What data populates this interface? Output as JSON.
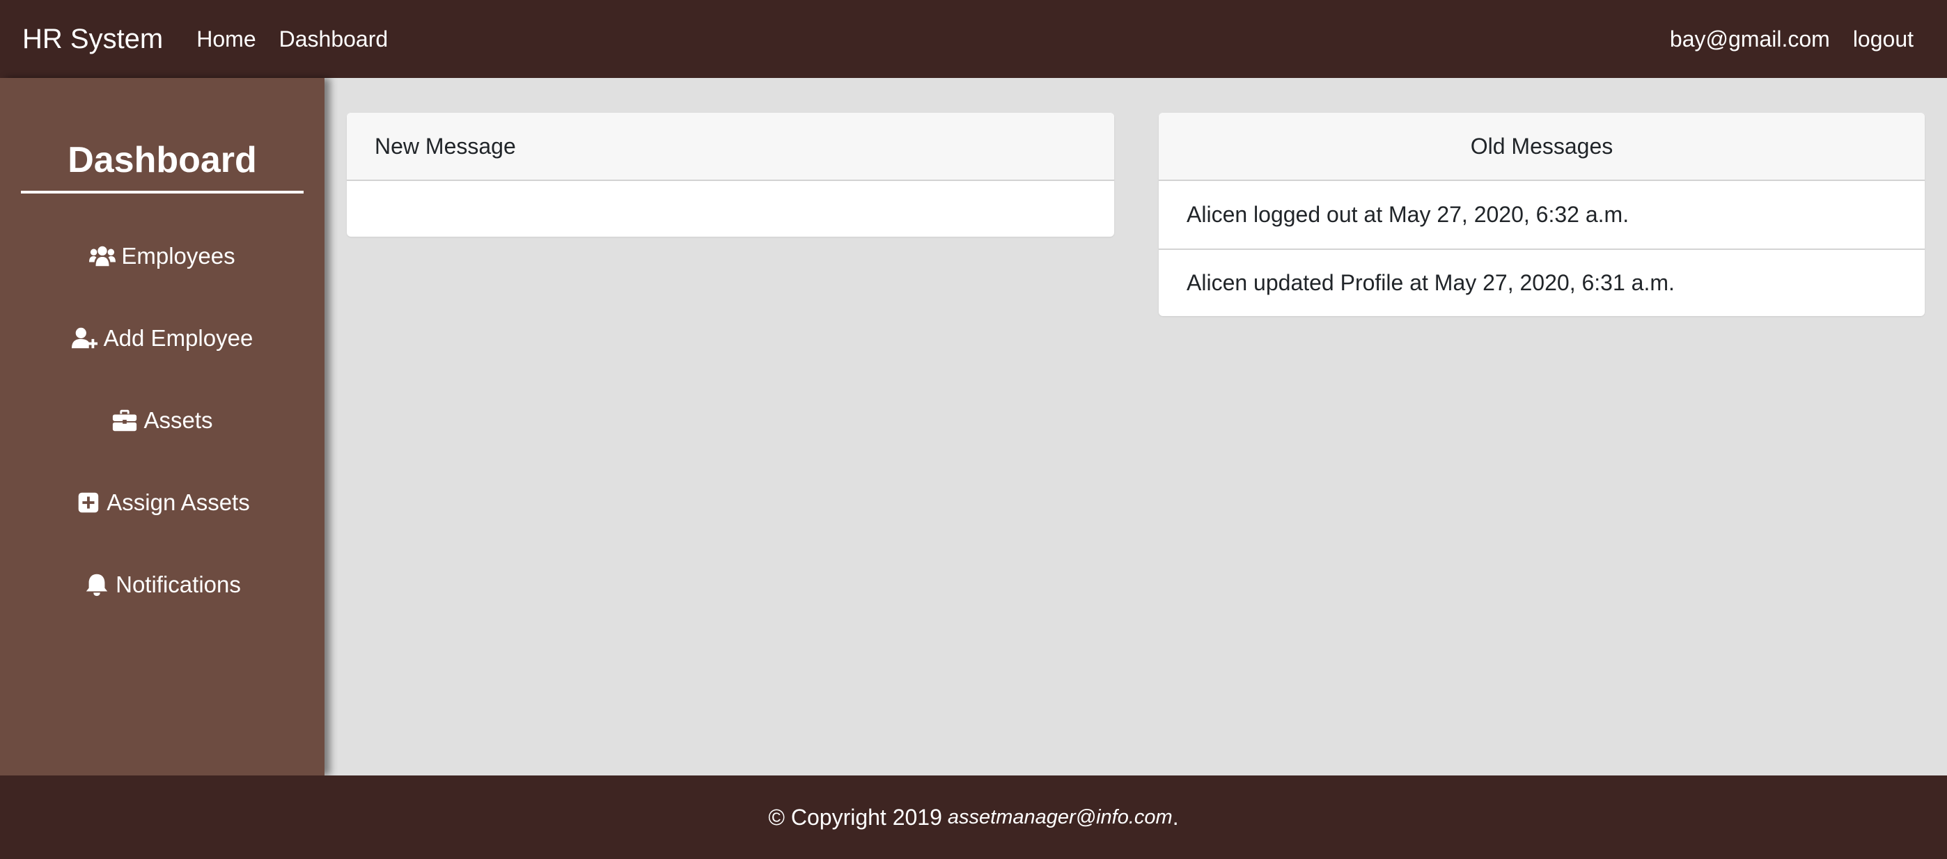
{
  "navbar": {
    "brand": "HR System",
    "links": [
      "Home",
      "Dashboard"
    ],
    "user_email": "bay@gmail.com",
    "logout_label": "logout"
  },
  "sidebar": {
    "title": "Dashboard",
    "items": [
      {
        "label": "Employees",
        "icon": "users-icon"
      },
      {
        "label": "Add Employee",
        "icon": "user-plus-icon"
      },
      {
        "label": "Assets",
        "icon": "briefcase-icon"
      },
      {
        "label": "Assign Assets",
        "icon": "plus-square-icon"
      },
      {
        "label": "Notifications",
        "icon": "bell-icon"
      }
    ]
  },
  "main": {
    "new_message": {
      "header": "New Message"
    },
    "old_messages": {
      "header": "Old Messages",
      "items": [
        "Alicen logged out at May 27, 2020, 6:32 a.m.",
        "Alicen updated Profile at May 27, 2020, 6:31 a.m."
      ]
    }
  },
  "footer": {
    "copyright": "© Copyright 2019",
    "email": "assetmanager@info.com",
    "suffix": "."
  },
  "colors": {
    "navbar_bg": "#3e2522",
    "sidebar_bg": "#6d4c41",
    "page_bg": "#e0e0e0"
  }
}
